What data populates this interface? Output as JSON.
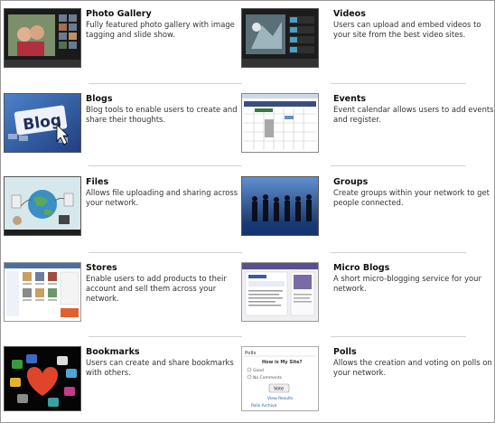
{
  "features": [
    {
      "key": "photo",
      "title": "Photo Gallery",
      "description": "Fully featured photo gallery with image tagging and slide show.",
      "icon": "photo-gallery-thumbnail"
    },
    {
      "key": "videos",
      "title": "Videos",
      "description": "Users can upload and embed videos to your site from the best video sites.",
      "icon": "videos-thumbnail"
    },
    {
      "key": "blogs",
      "title": "Blogs",
      "description": "Blog tools to enable users to create and share their thoughts.",
      "icon": "blog-thumbnail",
      "thumb_text": "Blog"
    },
    {
      "key": "events",
      "title": "Events",
      "description": "Event calendar allows users to add events and register.",
      "icon": "calendar-thumbnail"
    },
    {
      "key": "files",
      "title": "Files",
      "description": "Allows file uploading and sharing across your network.",
      "icon": "files-thumbnail"
    },
    {
      "key": "groups",
      "title": "Groups",
      "description": "Create groups within your network to get people connected.",
      "icon": "groups-thumbnail"
    },
    {
      "key": "stores",
      "title": "Stores",
      "description": "Enable users to add products to their account and sell them across your network.",
      "icon": "store-thumbnail"
    },
    {
      "key": "microblogs",
      "title": "Micro Blogs",
      "description": "A short micro-blogging service for your network.",
      "icon": "microblog-thumbnail"
    },
    {
      "key": "bookmarks",
      "title": "Bookmarks",
      "description": "Users can create and share bookmarks with others.",
      "icon": "bookmarks-thumbnail"
    },
    {
      "key": "polls",
      "title": "Polls",
      "description": "Allows the creation and voting on polls on your network.",
      "icon": "polls-thumbnail",
      "thumb_poll": {
        "header": "Polls",
        "question": "How is My Site?",
        "option1": "Good",
        "option2": "No Comments",
        "vote": "Vote",
        "results": "View Results",
        "archive": "Polls Archive"
      }
    }
  ]
}
